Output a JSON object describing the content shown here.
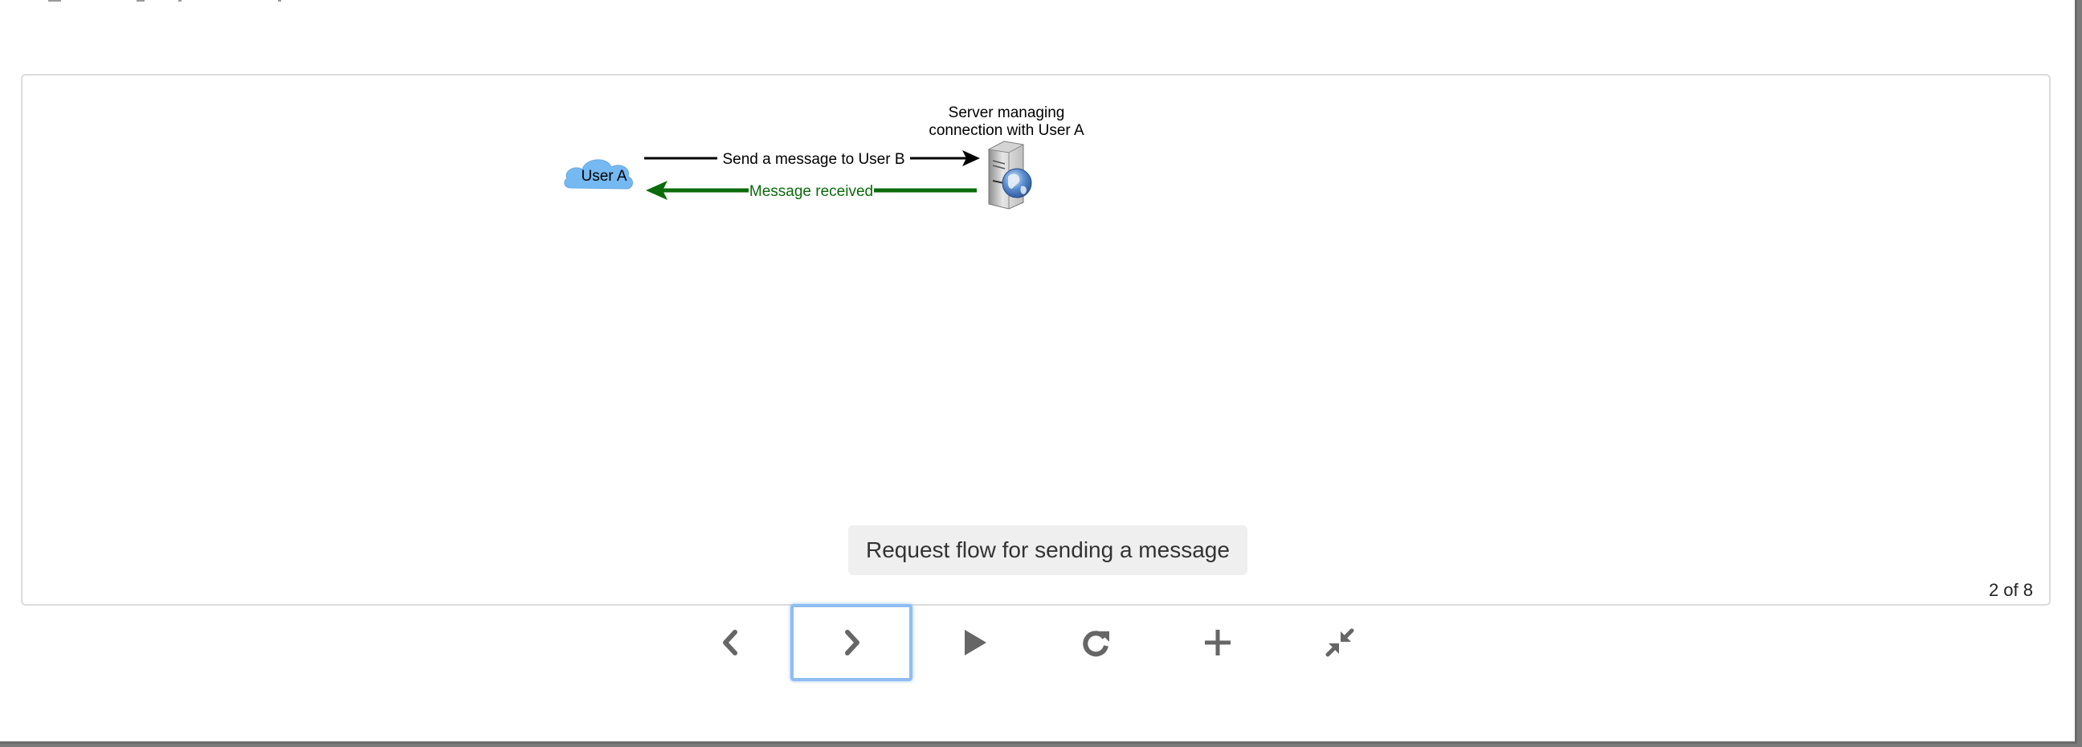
{
  "diagram": {
    "user_label": "User A",
    "server_label_line1": "Server managing",
    "server_label_line2": "connection with User A",
    "request_label": "Send a message to User B",
    "response_label": "Message received"
  },
  "caption": "Request flow for sending a message",
  "page_counter": "2 of 8",
  "controls": {
    "previous": "chevron-left-icon",
    "next": "chevron-right-icon",
    "play": "play-icon",
    "reload": "reload-icon",
    "zoom_in": "plus-icon",
    "collapse": "collapse-icon"
  },
  "colors": {
    "cloud": "#75b9f2",
    "response_arrow": "#0a6b0a",
    "focus_ring": "#8fbdf2",
    "control_icon": "#666666"
  }
}
